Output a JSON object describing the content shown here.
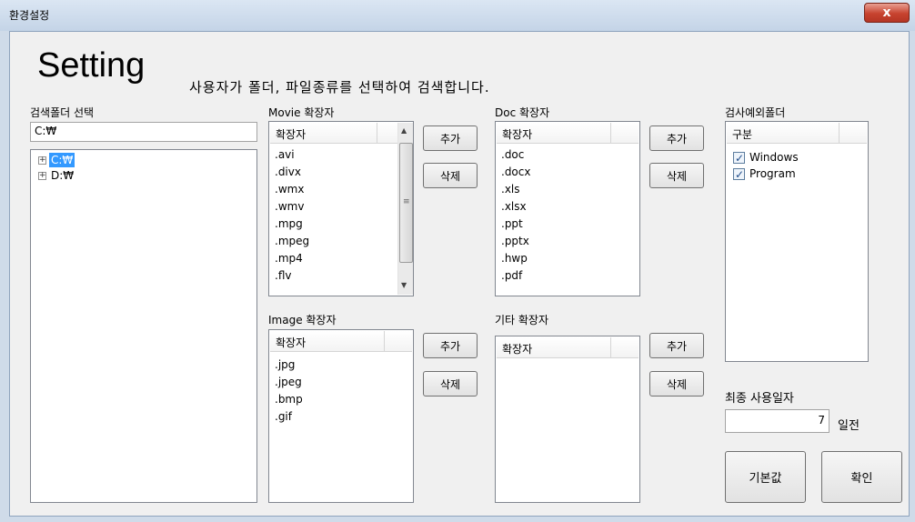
{
  "window": {
    "title": "환경설정",
    "close_glyph": "x"
  },
  "header": {
    "title": "Setting",
    "subtitle": "사용자가 폴더, 파일종류를 선택하여 검색합니다."
  },
  "search_folder": {
    "label": "검색폴더 선택",
    "path_value": "C:₩",
    "tree": [
      {
        "label": "C:₩",
        "selected": true
      },
      {
        "label": "D:₩",
        "selected": false
      }
    ]
  },
  "movie": {
    "label": "Movie 확장자",
    "column": "확장자",
    "items": [
      ".avi",
      ".divx",
      ".wmx",
      ".wmv",
      ".mpg",
      ".mpeg",
      ".mp4",
      ".flv"
    ],
    "add_label": "추가",
    "delete_label": "삭제"
  },
  "doc": {
    "label": "Doc 확장자",
    "column": "확장자",
    "items": [
      ".doc",
      ".docx",
      ".xls",
      ".xlsx",
      ".ppt",
      ".pptx",
      ".hwp",
      ".pdf"
    ],
    "add_label": "추가",
    "delete_label": "삭제"
  },
  "image": {
    "label": "Image 확장자",
    "column": "확장자",
    "items": [
      ".jpg",
      ".jpeg",
      ".bmp",
      ".gif"
    ],
    "add_label": "추가",
    "delete_label": "삭제"
  },
  "other": {
    "label": "기타 확장자",
    "column": "확장자",
    "items": [],
    "add_label": "추가",
    "delete_label": "삭제"
  },
  "exclude": {
    "label": "검사예외폴더",
    "column": "구분",
    "items": [
      {
        "label": "Windows",
        "checked": true
      },
      {
        "label": "Program",
        "checked": true
      }
    ]
  },
  "last_used": {
    "label": "최종 사용일자",
    "value": "7",
    "unit": "일전"
  },
  "footer": {
    "default_label": "기본값",
    "ok_label": "확인"
  }
}
